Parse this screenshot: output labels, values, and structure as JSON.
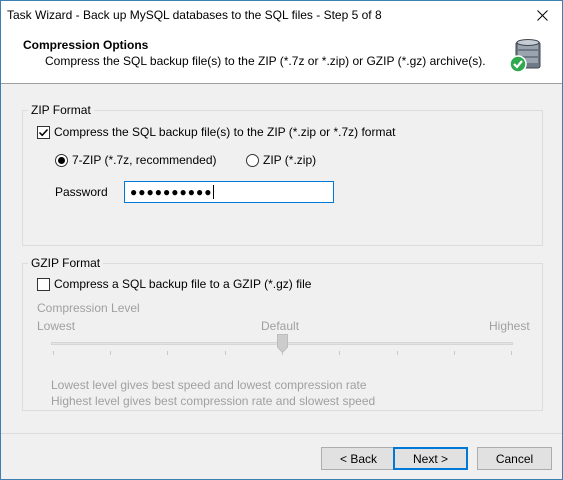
{
  "window": {
    "title": "Task Wizard - Back up MySQL databases to the SQL files - Step 5 of 8"
  },
  "header": {
    "title": "Compression Options",
    "subtitle": "Compress the SQL backup file(s) to the ZIP (*.7z or *.zip) or GZIP (*.gz) archive(s).",
    "icon": "database-check-icon"
  },
  "zip": {
    "group_label": "ZIP Format",
    "compress_label": "Compress the SQL backup file(s) to the ZIP (*.zip or *.7z) format",
    "compress_checked": true,
    "option_7zip": "7-ZIP (*.7z, recommended)",
    "option_7zip_selected": true,
    "option_zip": "ZIP (*.zip)",
    "password_label": "Password",
    "password_value": "●●●●●●●●●●"
  },
  "gzip": {
    "group_label": "GZIP Format",
    "compress_label": "Compress a SQL backup file to a GZIP (*.gz) file",
    "compress_checked": false,
    "level_label": "Compression Level",
    "lowest": "Lowest",
    "default": "Default",
    "highest": "Highest",
    "level_value": 0.5,
    "note1": "Lowest level gives best speed and lowest compression rate",
    "note2": "Highest level gives best compression rate and slowest speed"
  },
  "buttons": {
    "back": "< Back",
    "next": "Next >",
    "cancel": "Cancel"
  },
  "colors": {
    "accent": "#0078d7",
    "disabled_text": "#a0a0a0"
  }
}
